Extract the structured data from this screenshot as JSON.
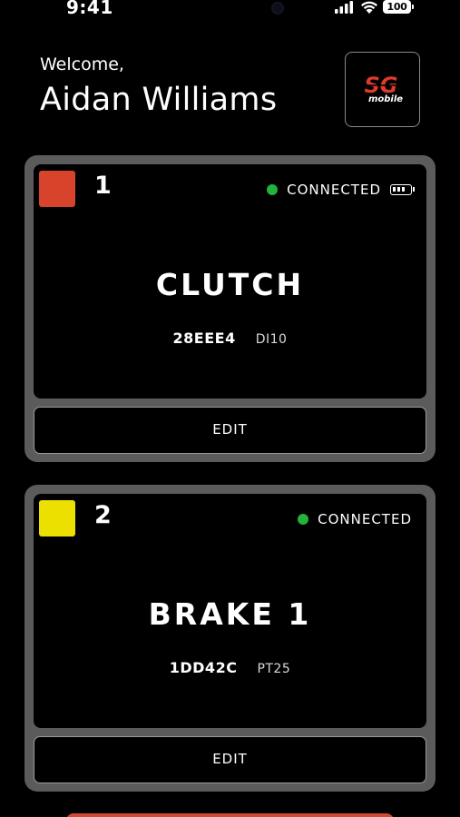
{
  "status_bar": {
    "time": "9:41",
    "battery": "100",
    "signal_icon": "signal-bars-icon",
    "wifi_icon": "wifi-icon"
  },
  "header": {
    "welcome": "Welcome,",
    "user_name": "Aidan Williams",
    "logo": {
      "text": "SG",
      "subtext": "mobile",
      "accent_color": "#e03a2a"
    }
  },
  "devices": [
    {
      "number": "1",
      "color": "#d8432c",
      "status": "CONNECTED",
      "status_color": "#22b33a",
      "name": "CLUTCH",
      "id": "28EEE4",
      "code": "DI10",
      "show_battery": true,
      "battery_icon": "battery-icon",
      "edit_label": "EDIT"
    },
    {
      "number": "2",
      "color": "#ece000",
      "status": "CONNECTED",
      "status_color": "#22b33a",
      "name": "BRAKE 1",
      "id": "1DD42C",
      "code": "PT25",
      "show_battery": false,
      "edit_label": "EDIT"
    }
  ],
  "bottom_button_color": "#d04a32"
}
